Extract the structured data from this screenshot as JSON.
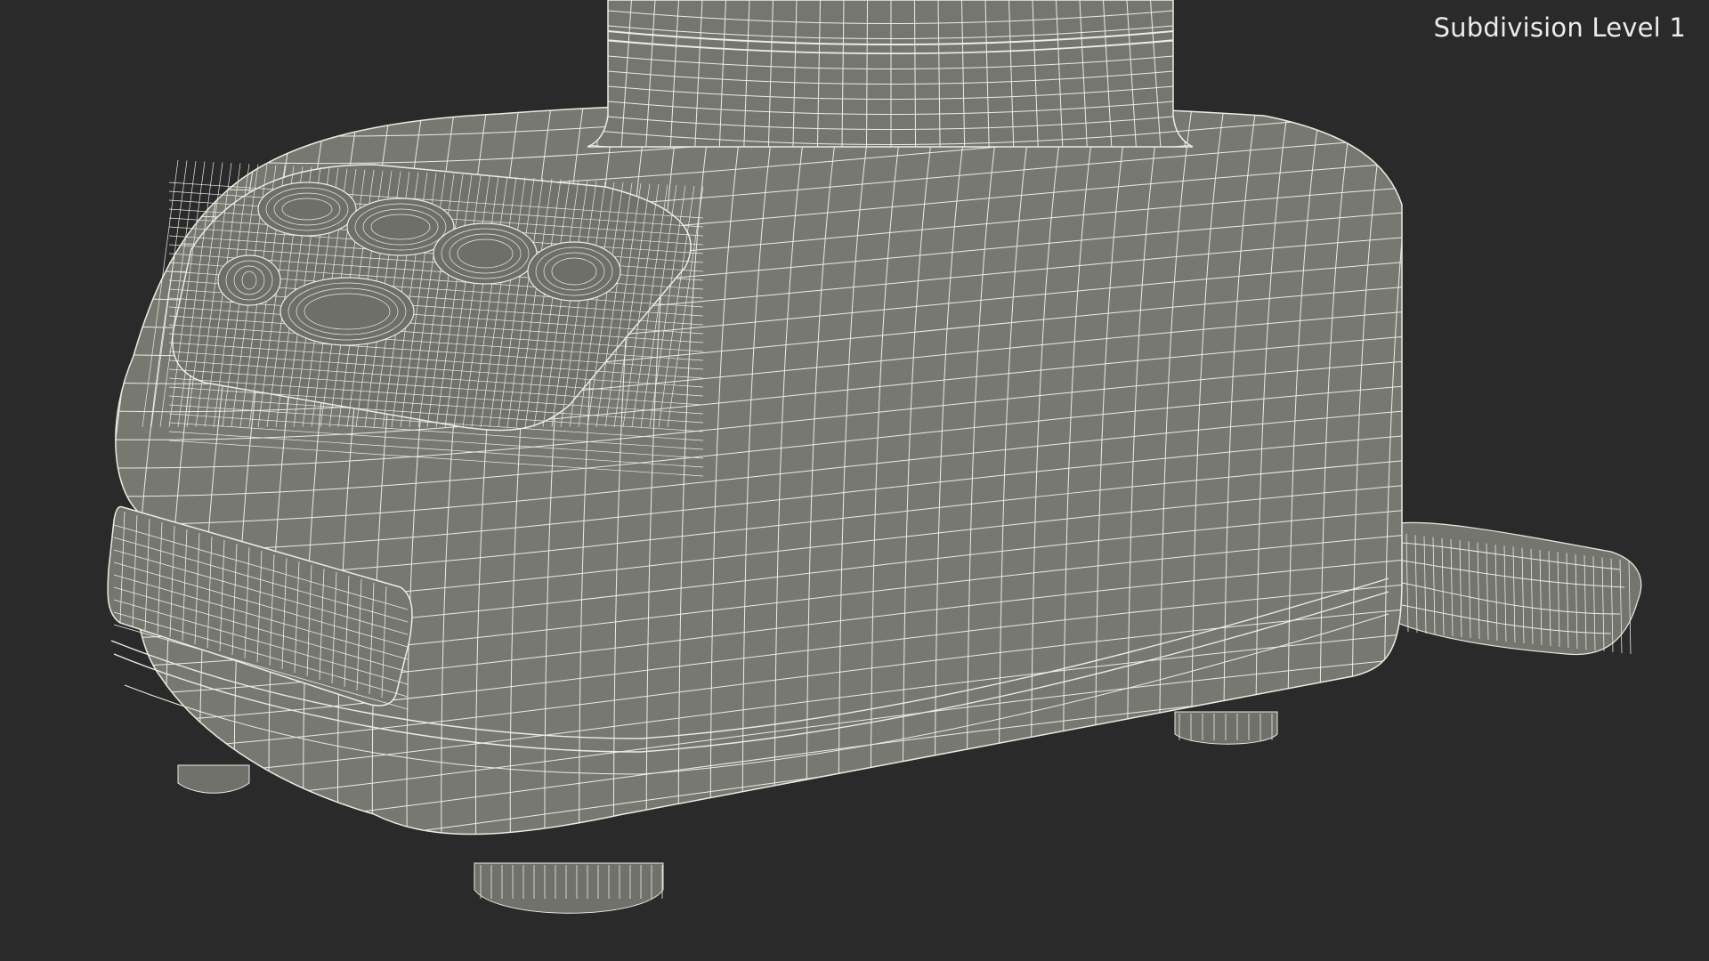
{
  "viewport": {
    "label": "Subdivision Level 1",
    "background_color": "#2a2a2a",
    "model_color": "#777870",
    "wire_color": "#ecece4"
  }
}
